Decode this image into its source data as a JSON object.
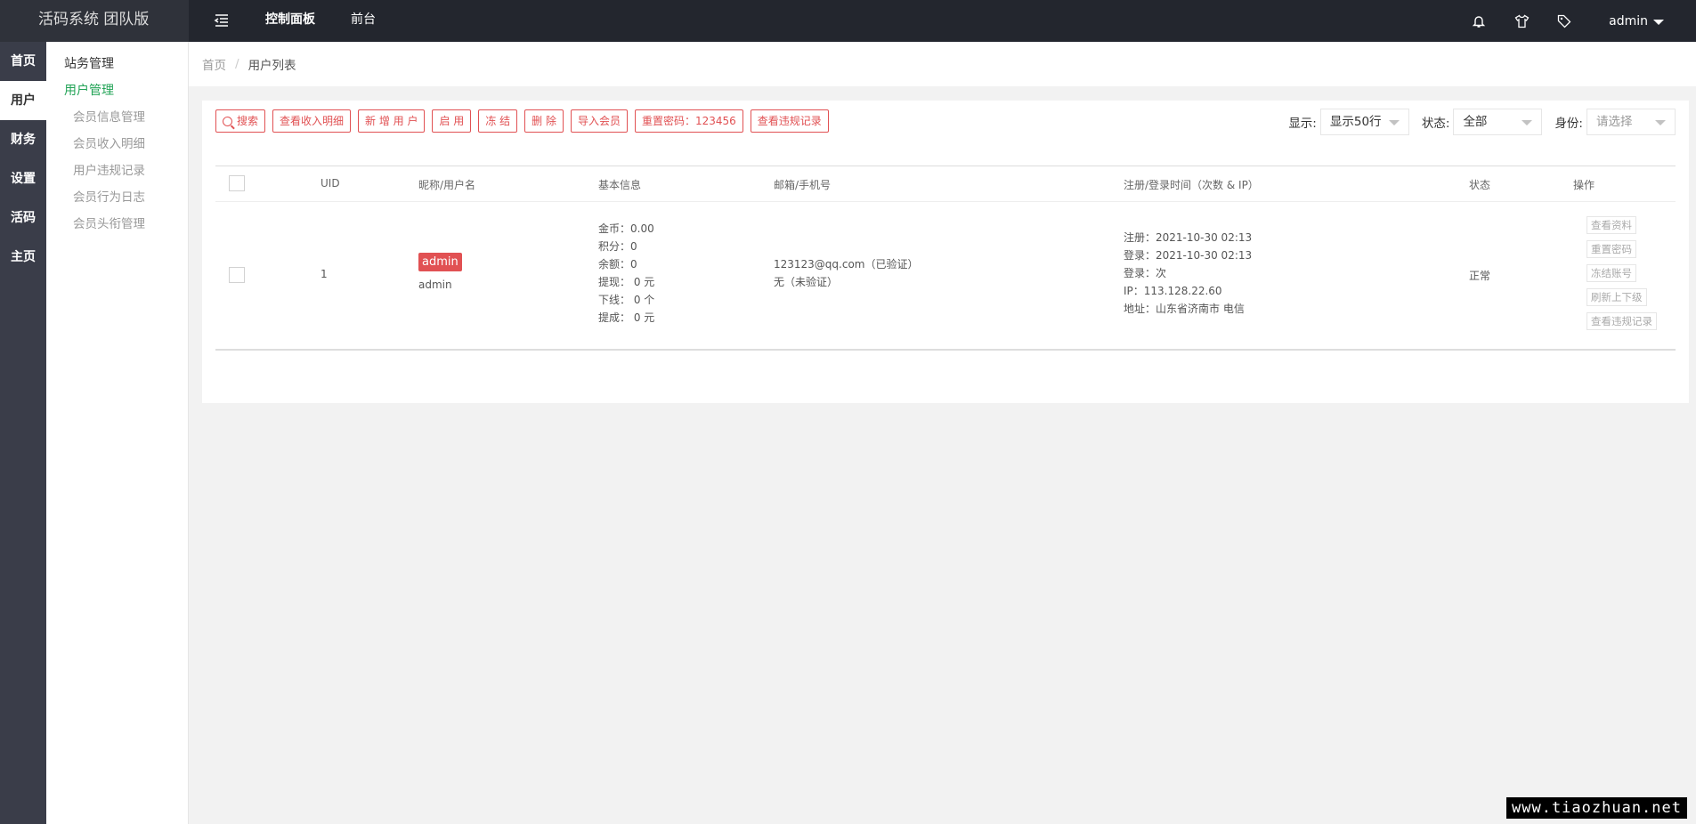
{
  "app": {
    "title": "活码系统 团队版"
  },
  "topnav": {
    "items": [
      "控制面板",
      "前台"
    ]
  },
  "user": {
    "name": "admin"
  },
  "icons": {
    "menu": "menu-fold-icon",
    "bell": "bell-icon",
    "theme": "tshirt-icon",
    "tag": "tag-icon",
    "search": "search-icon"
  },
  "leftbar": {
    "items": [
      "首页",
      "用户",
      "财务",
      "设置",
      "活码",
      "主页"
    ]
  },
  "submenu": {
    "groups": [
      "站务管理",
      "用户管理"
    ],
    "items": [
      "会员信息管理",
      "会员收入明细",
      "用户违规记录",
      "会员行为日志",
      "会员头衔管理"
    ]
  },
  "breadcrumb": {
    "home": "首页",
    "sep": "/",
    "current": "用户列表"
  },
  "toolbar": {
    "search": "搜索",
    "income": "查看收入明细",
    "add_user": "新 增 用 户",
    "enable": "启 用",
    "freeze": "冻 结",
    "delete": "删 除",
    "import": "导入会员",
    "reset_pwd": "重置密码：123456",
    "violations": "查看违规记录"
  },
  "filters": {
    "display_label": "显示:",
    "display_value": "显示50行",
    "status_label": "状态:",
    "status_value": "全部",
    "role_label": "身份:",
    "role_placeholder": "请选择"
  },
  "table": {
    "headers": {
      "uid": "UID",
      "name": "昵称/用户名",
      "basic": "基本信息",
      "contact": "邮箱/手机号",
      "reg": "注册/登录时间（次数 & IP）",
      "status": "状态",
      "actions": "操作"
    },
    "rows": [
      {
        "uid": "1",
        "tag": "admin",
        "username": "admin",
        "basic": [
          "金币：0.00",
          "积分：0",
          "余额：0",
          "提现： 0 元",
          "下线： 0 个",
          "提成： 0 元"
        ],
        "contact": [
          "123123@qq.com（已验证）",
          "无（未验证）"
        ],
        "reg": [
          "注册：2021-10-30 02:13",
          "登录：2021-10-30 02:13",
          "登录：次",
          "IP：113.128.22.60",
          "地址：山东省济南市 电信"
        ],
        "status": "正常",
        "actions": [
          "查看资料",
          "重置密码",
          "冻结账号",
          "刷新上下级",
          "查看违规记录"
        ]
      }
    ]
  },
  "watermark": "www.tiaozhuan.net"
}
